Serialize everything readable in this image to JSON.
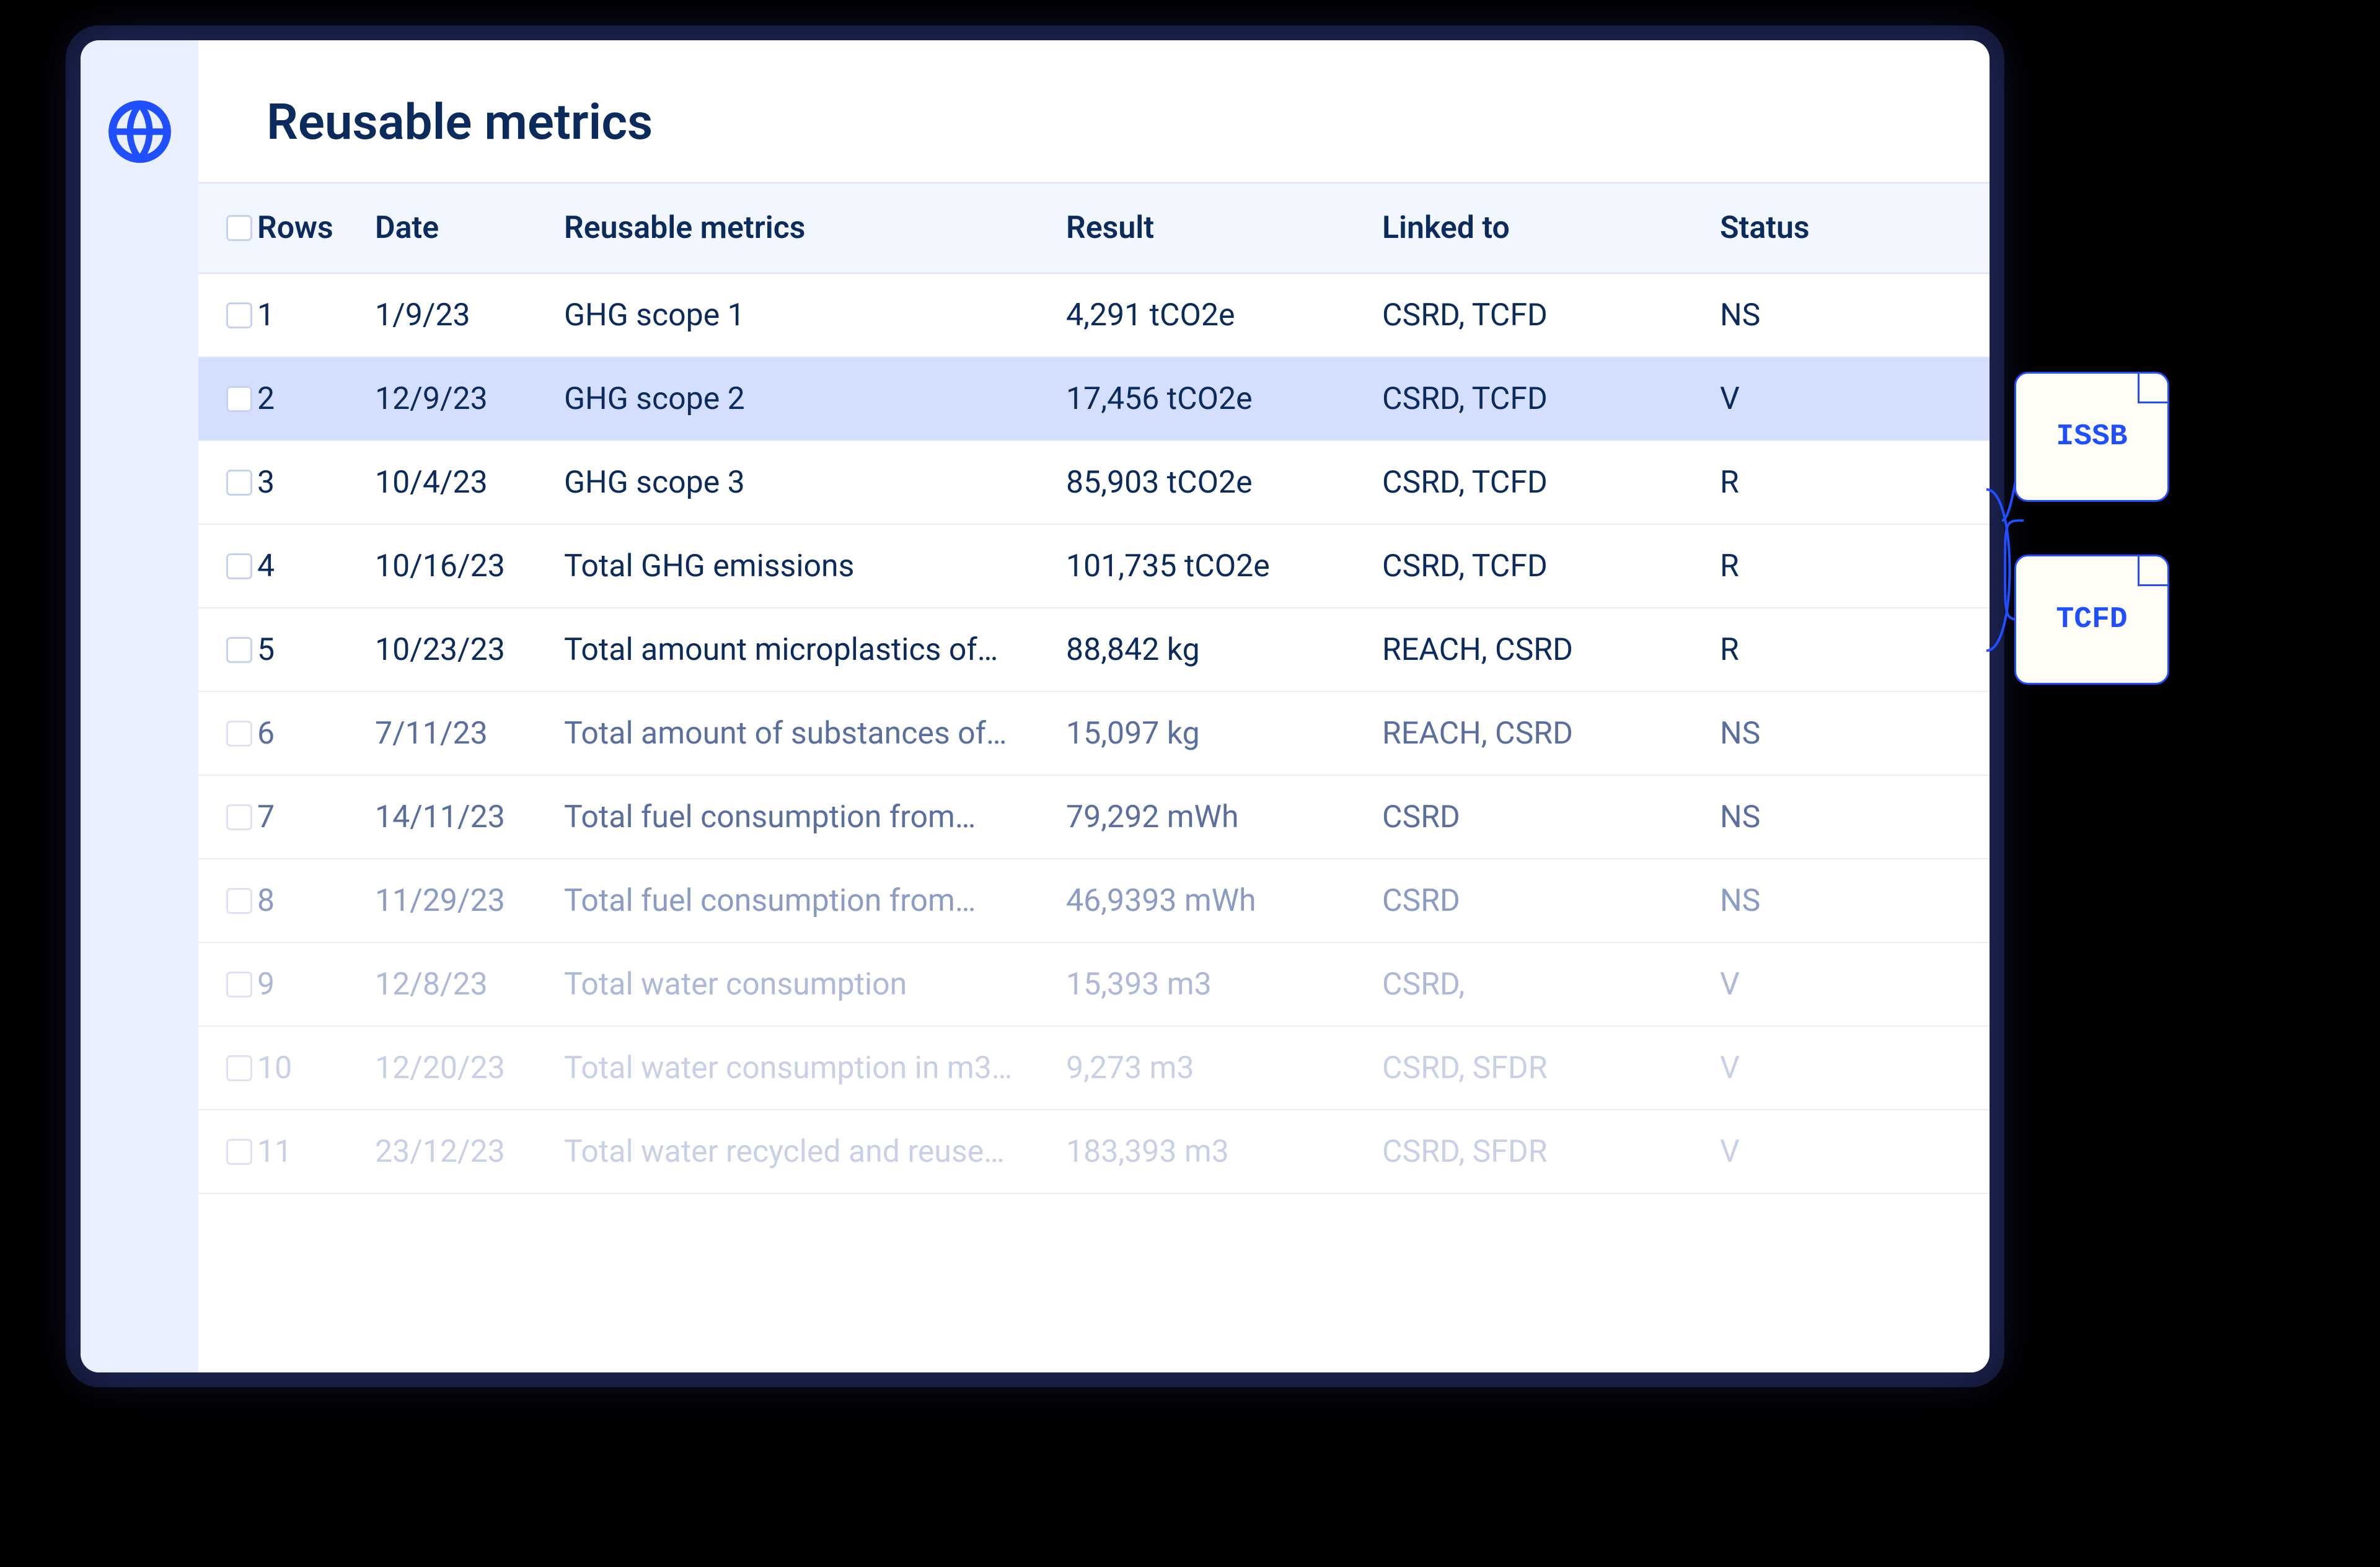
{
  "page_title": "Reusable metrics",
  "columns": {
    "rows": "Rows",
    "date": "Date",
    "metric": "Reusable metrics",
    "result": "Result",
    "linked": "Linked to",
    "status": "Status"
  },
  "rows": [
    {
      "n": "1",
      "date": "1/9/23",
      "metric": "GHG scope 1",
      "result": "4,291 tCO2e",
      "linked": "CSRD, TCFD",
      "status": "NS"
    },
    {
      "n": "2",
      "date": "12/9/23",
      "metric": "GHG scope 2",
      "result": "17,456 tCO2e",
      "linked": "CSRD, TCFD",
      "status": "V"
    },
    {
      "n": "3",
      "date": "10/4/23",
      "metric": "GHG scope 3",
      "result": "85,903 tCO2e",
      "linked": "CSRD, TCFD",
      "status": "R"
    },
    {
      "n": "4",
      "date": "10/16/23",
      "metric": "Total GHG emissions",
      "result": "101,735 tCO2e",
      "linked": "CSRD, TCFD",
      "status": "R"
    },
    {
      "n": "5",
      "date": "10/23/23",
      "metric": "Total amount microplastics of…",
      "result": "88,842 kg",
      "linked": "REACH, CSRD",
      "status": "R"
    },
    {
      "n": "6",
      "date": "7/11/23",
      "metric": "Total amount of substances of…",
      "result": "15,097 kg",
      "linked": "REACH, CSRD",
      "status": "NS"
    },
    {
      "n": "7",
      "date": "14/11/23",
      "metric": "Total fuel consumption from…",
      "result": "79,292 mWh",
      "linked": "CSRD",
      "status": "NS"
    },
    {
      "n": "8",
      "date": "11/29/23",
      "metric": "Total fuel consumption from…",
      "result": "46,9393 mWh",
      "linked": "CSRD",
      "status": "NS"
    },
    {
      "n": "9",
      "date": "12/8/23",
      "metric": "Total water consumption",
      "result": "15,393 m3",
      "linked": "CSRD,",
      "status": "V"
    },
    {
      "n": "10",
      "date": "12/20/23",
      "metric": "Total water consumption in m3…",
      "result": "9,273 m3",
      "linked": "CSRD, SFDR",
      "status": "V"
    },
    {
      "n": "11",
      "date": "23/12/23",
      "metric": "Total water recycled and reuse…",
      "result": "183,393 m3",
      "linked": "CSRD, SFDR",
      "status": "V"
    }
  ],
  "tags": [
    "ISSB",
    "TCFD"
  ],
  "colors": {
    "accent": "#1f4fff",
    "text_primary": "#0b2b5c",
    "sidebar_bg": "#eaf0ff",
    "header_bg": "#f2f6ff",
    "row_selected": "#d4deff"
  }
}
